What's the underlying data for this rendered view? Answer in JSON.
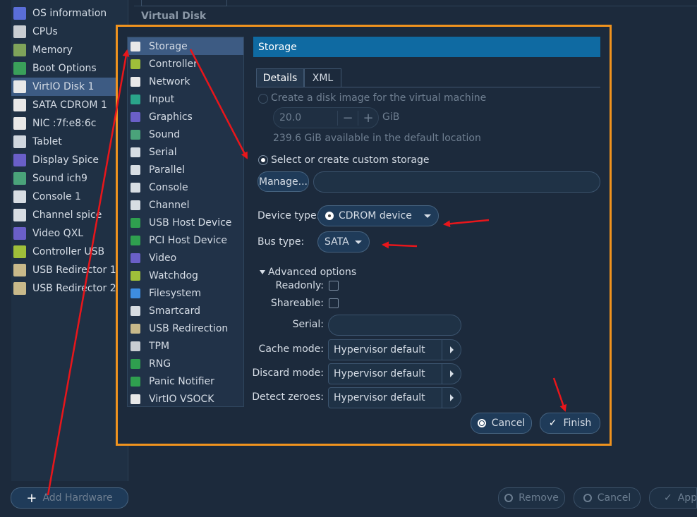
{
  "left_panel": {
    "items": [
      {
        "label": "OS information",
        "icon": "monitor-icon",
        "color": "#5a6ed8"
      },
      {
        "label": "CPUs",
        "icon": "cpu-icon",
        "color": "#c9cdd2"
      },
      {
        "label": "Memory",
        "icon": "memory-icon",
        "color": "#7fa35a"
      },
      {
        "label": "Boot Options",
        "icon": "boot-icon",
        "color": "#3aa05a"
      },
      {
        "label": "VirtIO Disk 1",
        "icon": "disk-icon",
        "color": "#e8e8e8"
      },
      {
        "label": "SATA CDROM 1",
        "icon": "cdrom-icon",
        "color": "#e8e8e8"
      },
      {
        "label": "NIC :7f:e8:6c",
        "icon": "network-icon",
        "color": "#e8e8e8"
      },
      {
        "label": "Tablet",
        "icon": "tablet-icon",
        "color": "#cfd6de"
      },
      {
        "label": "Display Spice",
        "icon": "display-icon",
        "color": "#6a5fc8"
      },
      {
        "label": "Sound ich9",
        "icon": "sound-icon",
        "color": "#4aa37a"
      },
      {
        "label": "Console 1",
        "icon": "console-icon",
        "color": "#d7dde3"
      },
      {
        "label": "Channel spice",
        "icon": "channel-icon",
        "color": "#d7dde3"
      },
      {
        "label": "Video QXL",
        "icon": "video-icon",
        "color": "#6a5fc8"
      },
      {
        "label": "Controller USB",
        "icon": "controller-icon",
        "color": "#9fbf3a"
      },
      {
        "label": "USB Redirector 1",
        "icon": "usb-redirect-icon",
        "color": "#c8b98a"
      },
      {
        "label": "USB Redirector 2",
        "icon": "usb-redirect-icon",
        "color": "#c8b98a"
      }
    ],
    "selected": "VirtIO Disk 1",
    "add_hardware": "Add Hardware"
  },
  "background": {
    "section_title": "Virtual Disk",
    "remove": "Remove",
    "cancel": "Cancel",
    "apply": "Apply"
  },
  "dialog": {
    "types": [
      {
        "label": "Storage",
        "icon": "storage-icon",
        "color": "#e8e8e8"
      },
      {
        "label": "Controller",
        "icon": "controller-icon",
        "color": "#9fbf3a"
      },
      {
        "label": "Network",
        "icon": "network-icon",
        "color": "#e8e8e8"
      },
      {
        "label": "Input",
        "icon": "input-icon",
        "color": "#2aa58a"
      },
      {
        "label": "Graphics",
        "icon": "graphics-icon",
        "color": "#6a5fc8"
      },
      {
        "label": "Sound",
        "icon": "sound-icon",
        "color": "#4aa37a"
      },
      {
        "label": "Serial",
        "icon": "serial-icon",
        "color": "#d7dde3"
      },
      {
        "label": "Parallel",
        "icon": "parallel-icon",
        "color": "#d7dde3"
      },
      {
        "label": "Console",
        "icon": "console-icon",
        "color": "#d7dde3"
      },
      {
        "label": "Channel",
        "icon": "channel-icon",
        "color": "#d7dde3"
      },
      {
        "label": "USB Host Device",
        "icon": "usb-host-icon",
        "color": "#2f9f4f"
      },
      {
        "label": "PCI Host Device",
        "icon": "pci-host-icon",
        "color": "#2f9f4f"
      },
      {
        "label": "Video",
        "icon": "video-icon",
        "color": "#6a5fc8"
      },
      {
        "label": "Watchdog",
        "icon": "watchdog-icon",
        "color": "#9fbf3a"
      },
      {
        "label": "Filesystem",
        "icon": "folder-icon",
        "color": "#3e8de0"
      },
      {
        "label": "Smartcard",
        "icon": "smartcard-icon",
        "color": "#d7dde3"
      },
      {
        "label": "USB Redirection",
        "icon": "usb-redirect-icon",
        "color": "#c8b98a"
      },
      {
        "label": "TPM",
        "icon": "tpm-icon",
        "color": "#c9cdd2"
      },
      {
        "label": "RNG",
        "icon": "rng-icon",
        "color": "#2f9f4f"
      },
      {
        "label": "Panic Notifier",
        "icon": "panic-icon",
        "color": "#2f9f4f"
      },
      {
        "label": "VirtIO VSOCK",
        "icon": "vsock-icon",
        "color": "#e8e8e8"
      }
    ],
    "selected_type": "Storage",
    "header": "Storage",
    "tabs": [
      "Details",
      "XML"
    ],
    "active_tab": "Details",
    "create_image_label": "Create a disk image for the virtual machine",
    "size_value": "20.0",
    "size_unit": "GiB",
    "available_text": "239.6 GiB available in the default location",
    "custom_storage_label": "Select or create custom storage",
    "manage_button": "Manage...",
    "custom_path_value": "",
    "device_type_label": "Device type:",
    "device_type_value": "CDROM device",
    "bus_type_label": "Bus type:",
    "bus_type_value": "SATA",
    "advanced_label": "Advanced options",
    "readonly_label": "Readonly:",
    "shareable_label": "Shareable:",
    "serial_label": "Serial:",
    "serial_value": "",
    "cache_mode_label": "Cache mode:",
    "cache_mode_value": "Hypervisor default",
    "discard_mode_label": "Discard mode:",
    "discard_mode_value": "Hypervisor default",
    "detect_zeroes_label": "Detect zeroes:",
    "detect_zeroes_value": "Hypervisor default",
    "cancel_button": "Cancel",
    "finish_button": "Finish"
  },
  "colors": {
    "highlight_border": "#f0931e",
    "annotation_arrow": "#e8161b",
    "header_bg": "#0f6aa2",
    "selection": "#3d5b83"
  }
}
